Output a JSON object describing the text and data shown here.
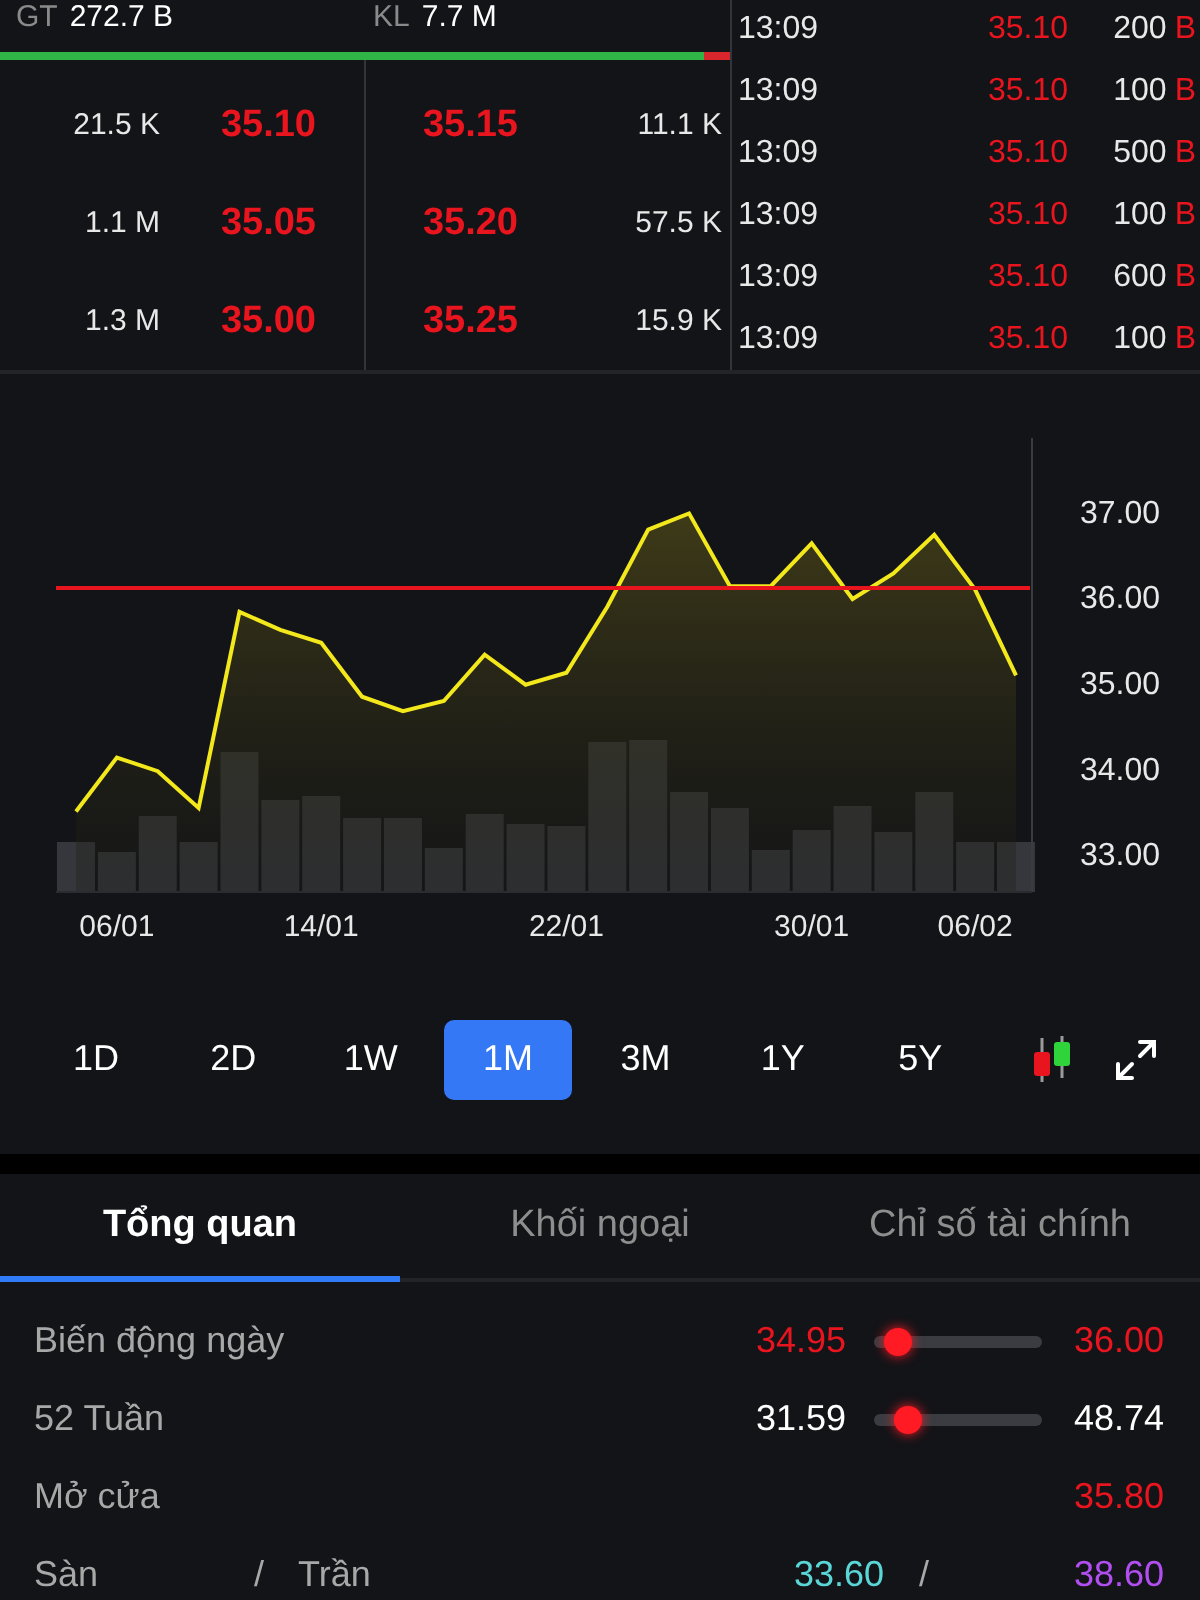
{
  "summary": [
    {
      "label": "GT",
      "value": "272.7 B"
    },
    {
      "label": "KL",
      "value": "7.7 M"
    }
  ],
  "buy_sell_balance": {
    "level": 0.965
  },
  "order_book": [
    {
      "bid_volume": "21.5 K",
      "bid_price": "35.10",
      "ask_price": "35.15",
      "ask_volume": "11.1 K"
    },
    {
      "bid_volume": "1.1 M",
      "bid_price": "35.05",
      "ask_price": "35.20",
      "ask_volume": "57.5 K"
    },
    {
      "bid_volume": "1.3 M",
      "bid_price": "35.00",
      "ask_price": "35.25",
      "ask_volume": "15.9 K"
    }
  ],
  "trades": [
    {
      "time": "13:09",
      "price": "35.10",
      "volume": "200",
      "side": "B"
    },
    {
      "time": "13:09",
      "price": "35.10",
      "volume": "100",
      "side": "B"
    },
    {
      "time": "13:09",
      "price": "35.10",
      "volume": "500",
      "side": "B"
    },
    {
      "time": "13:09",
      "price": "35.10",
      "volume": "100",
      "side": "B"
    },
    {
      "time": "13:09",
      "price": "35.10",
      "volume": "600",
      "side": "B"
    },
    {
      "time": "13:09",
      "price": "35.10",
      "volume": "100",
      "side": "B"
    }
  ],
  "chart": {
    "chart_data": {
      "type": "area",
      "categories": [
        null,
        "06/01",
        null,
        null,
        null,
        null,
        "14/01",
        null,
        null,
        null,
        null,
        null,
        "22/01",
        null,
        null,
        null,
        null,
        null,
        "30/01",
        null,
        null,
        null,
        "06/02",
        null
      ],
      "series": [
        {
          "color": "#f2e81c",
          "values": [
            33.49,
            34.12,
            33.96,
            33.53,
            35.82,
            35.61,
            35.46,
            34.83,
            34.66,
            34.78,
            35.32,
            34.97,
            35.11,
            35.88,
            36.78,
            36.97,
            36.12,
            36.12,
            36.62,
            35.97,
            36.27,
            36.72,
            36.08,
            35.08
          ]
        }
      ],
      "ylim": [
        32.55,
        37.85
      ],
      "yticks": [
        {
          "value": 33,
          "label": "33.00"
        },
        {
          "value": 34,
          "label": "34.00"
        },
        {
          "value": 35,
          "label": "35.00"
        },
        {
          "value": 36,
          "label": "36.00"
        },
        {
          "value": 37,
          "label": "37.00"
        }
      ],
      "ref_lines": [
        {
          "axis": "y",
          "value": 36.1,
          "color": "#e8141e"
        }
      ]
    }
  },
  "periods": [
    {
      "label": "1D",
      "selected": false
    },
    {
      "label": "2D",
      "selected": false
    },
    {
      "label": "1W",
      "selected": false
    },
    {
      "label": "1M",
      "selected": true
    },
    {
      "label": "3M",
      "selected": false
    },
    {
      "label": "1Y",
      "selected": false
    },
    {
      "label": "5Y",
      "selected": false
    }
  ],
  "tabs": [
    {
      "label": "Tổng quan",
      "selected": true
    },
    {
      "label": "Khối ngoại",
      "selected": false
    },
    {
      "label": "Chỉ số tài chính",
      "selected": false
    }
  ],
  "stats": [
    {
      "kind": "range",
      "label": "Biến động ngày",
      "low": {
        "value": "34.95",
        "color": "#e8141e"
      },
      "level": 0.14,
      "high": {
        "value": "36.00",
        "color": "#e8141e"
      }
    },
    {
      "kind": "range",
      "label": "52 Tuần",
      "low": {
        "value": "31.59",
        "color": "#ffffff"
      },
      "level": 0.2,
      "high": {
        "value": "48.74",
        "color": "#ffffff"
      }
    },
    {
      "kind": "value",
      "label": "Mở cửa",
      "value": "35.80",
      "color": "#e8141e"
    },
    {
      "kind": "pair",
      "label": "Sàn",
      "separator": "/",
      "label2": "Trần",
      "floor": {
        "value": "33.60",
        "color": "#5ad6d6"
      },
      "separator2": "/",
      "ceiling": {
        "value": "38.60",
        "color": "#b04ef0"
      }
    }
  ]
}
